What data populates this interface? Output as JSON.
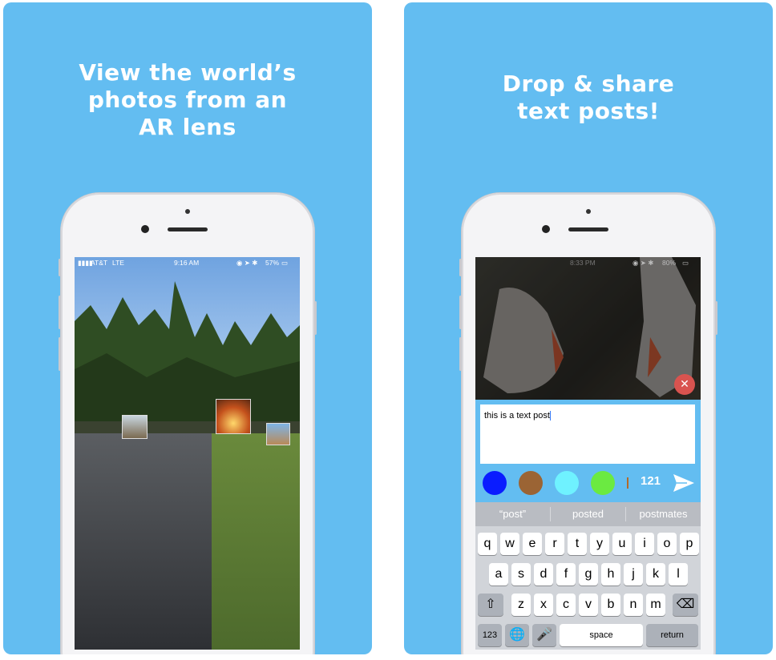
{
  "left_panel": {
    "headline": [
      "View the world’s",
      "photos from an",
      "AR lens"
    ],
    "status": {
      "carrier": "AT&T",
      "network": "LTE",
      "time": "9:16 AM",
      "battery": "57%"
    }
  },
  "right_panel": {
    "headline": [
      "Drop & share",
      "text posts!"
    ],
    "status": {
      "time": "8:33 PM",
      "battery": "80%"
    },
    "close_icon": "close-icon",
    "text_input_value": "this is a text post",
    "colors": [
      "#0a1cff",
      "#9b6434",
      "#6ff2ff",
      "#6bea41"
    ],
    "char_count": "121",
    "send_icon": "send-icon",
    "suggestions": [
      "“post”",
      "posted",
      "postmates"
    ],
    "keyboard": {
      "row1": [
        "q",
        "w",
        "e",
        "r",
        "t",
        "y",
        "u",
        "i",
        "o",
        "p"
      ],
      "row2": [
        "a",
        "s",
        "d",
        "f",
        "g",
        "h",
        "j",
        "k",
        "l"
      ],
      "row3": [
        "z",
        "x",
        "c",
        "v",
        "b",
        "n",
        "m"
      ],
      "numbers_key": "123",
      "space_key": "space",
      "return_key": "return"
    }
  }
}
